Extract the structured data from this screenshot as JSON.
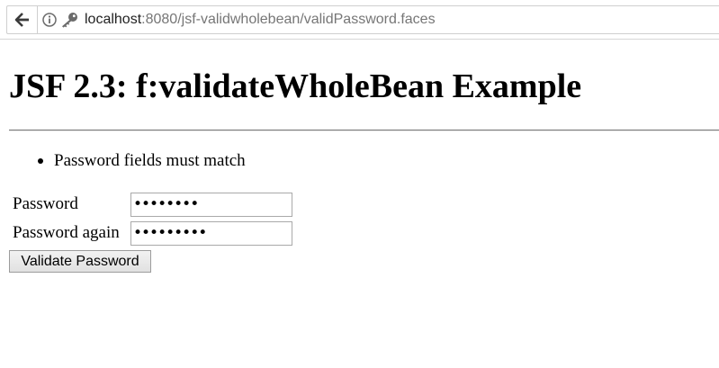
{
  "browser": {
    "url_host": "localhost",
    "url_rest": ":8080/jsf-validwholebean/validPassword.faces"
  },
  "page": {
    "heading": "JSF 2.3: f:validateWholeBean Example",
    "messages": [
      "Password fields must match"
    ],
    "form": {
      "password_label": "Password",
      "password_value": "••••••••",
      "password_again_label": "Password again",
      "password_again_value": "•••••••••",
      "submit_label": "Validate Password"
    }
  }
}
